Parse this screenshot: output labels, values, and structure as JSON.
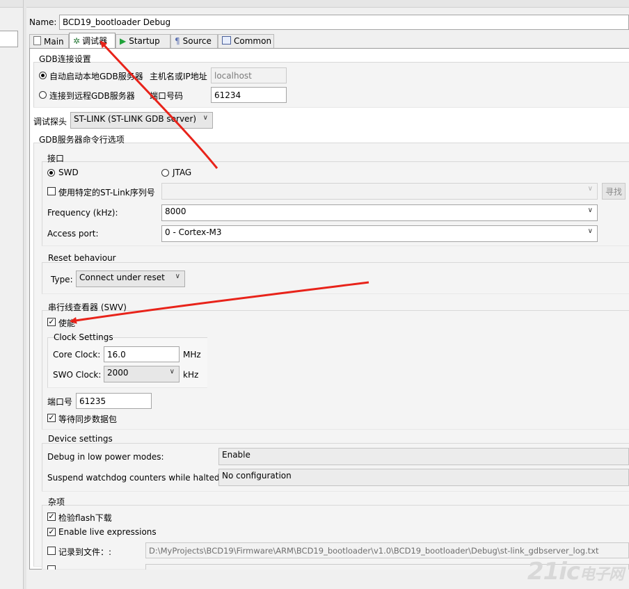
{
  "name_label": "Name:",
  "name_value": "BCD19_bootloader Debug",
  "tabs": [
    {
      "label": "Main",
      "icon": "file-icon"
    },
    {
      "label": "调试器",
      "icon": "debugger-icon"
    },
    {
      "label": "Startup",
      "icon": "play-icon"
    },
    {
      "label": "Source",
      "icon": "source-icon"
    },
    {
      "label": "Common",
      "icon": "common-icon"
    }
  ],
  "gdb_connection": {
    "title": "GDB连接设置",
    "auto_start": "自动启动本地GDB服务器",
    "connect_remote": "连接到远程GDB服务器",
    "host_label": "主机名或IP地址",
    "host_value": "localhost",
    "port_label": "端口号码",
    "port_value": "61234"
  },
  "probe": {
    "label": "调试探头",
    "value": "ST-LINK (ST-LINK GDB server)"
  },
  "gdb_server_options": {
    "title": "GDB服务器命令行选项",
    "interface": {
      "title": "接口",
      "swd": "SWD",
      "jtag": "JTAG",
      "serial_check": "使用特定的ST-Link序列号",
      "find_button": "寻找",
      "frequency_label": "Frequency (kHz):",
      "frequency_value": "8000",
      "access_port_label": "Access port:",
      "access_port_value": "0 - Cortex-M3"
    },
    "reset": {
      "title": "Reset behaviour",
      "type_label": "Type:",
      "type_value": "Connect under reset"
    },
    "swv": {
      "title": "串行线查看器 (SWV)",
      "enable": "使能",
      "clock_title": "Clock Settings",
      "core_clock_label": "Core Clock:",
      "core_clock_value": "16.0",
      "core_clock_unit": "MHz",
      "swo_clock_label": "SWO Clock:",
      "swo_clock_value": "2000",
      "swo_clock_unit": "kHz",
      "port_label": "端口号",
      "port_value": "61235",
      "wait_sync": "等待同步数据包"
    },
    "device": {
      "title": "Device settings",
      "low_power_label": "Debug in low power modes:",
      "low_power_value": "Enable",
      "watchdog_label": "Suspend watchdog counters while halted:",
      "watchdog_value": "No configuration"
    },
    "misc": {
      "title": "杂项",
      "verify_flash": "检验flash下载",
      "live_expr": "Enable live expressions",
      "log_to_file": "记录到文件：:",
      "log_path": "D:\\MyProjects\\BCD19\\Firmware\\ARM\\BCD19_bootloader\\v1.0\\BCD19_bootloader\\Debug\\st-link_gdbserver_log.txt"
    }
  },
  "watermark": {
    "main": "21ic",
    "sub": "电子网"
  },
  "colors": {
    "annotation_arrow": "#e8231a",
    "panel_bg": "#f0f0f0"
  }
}
